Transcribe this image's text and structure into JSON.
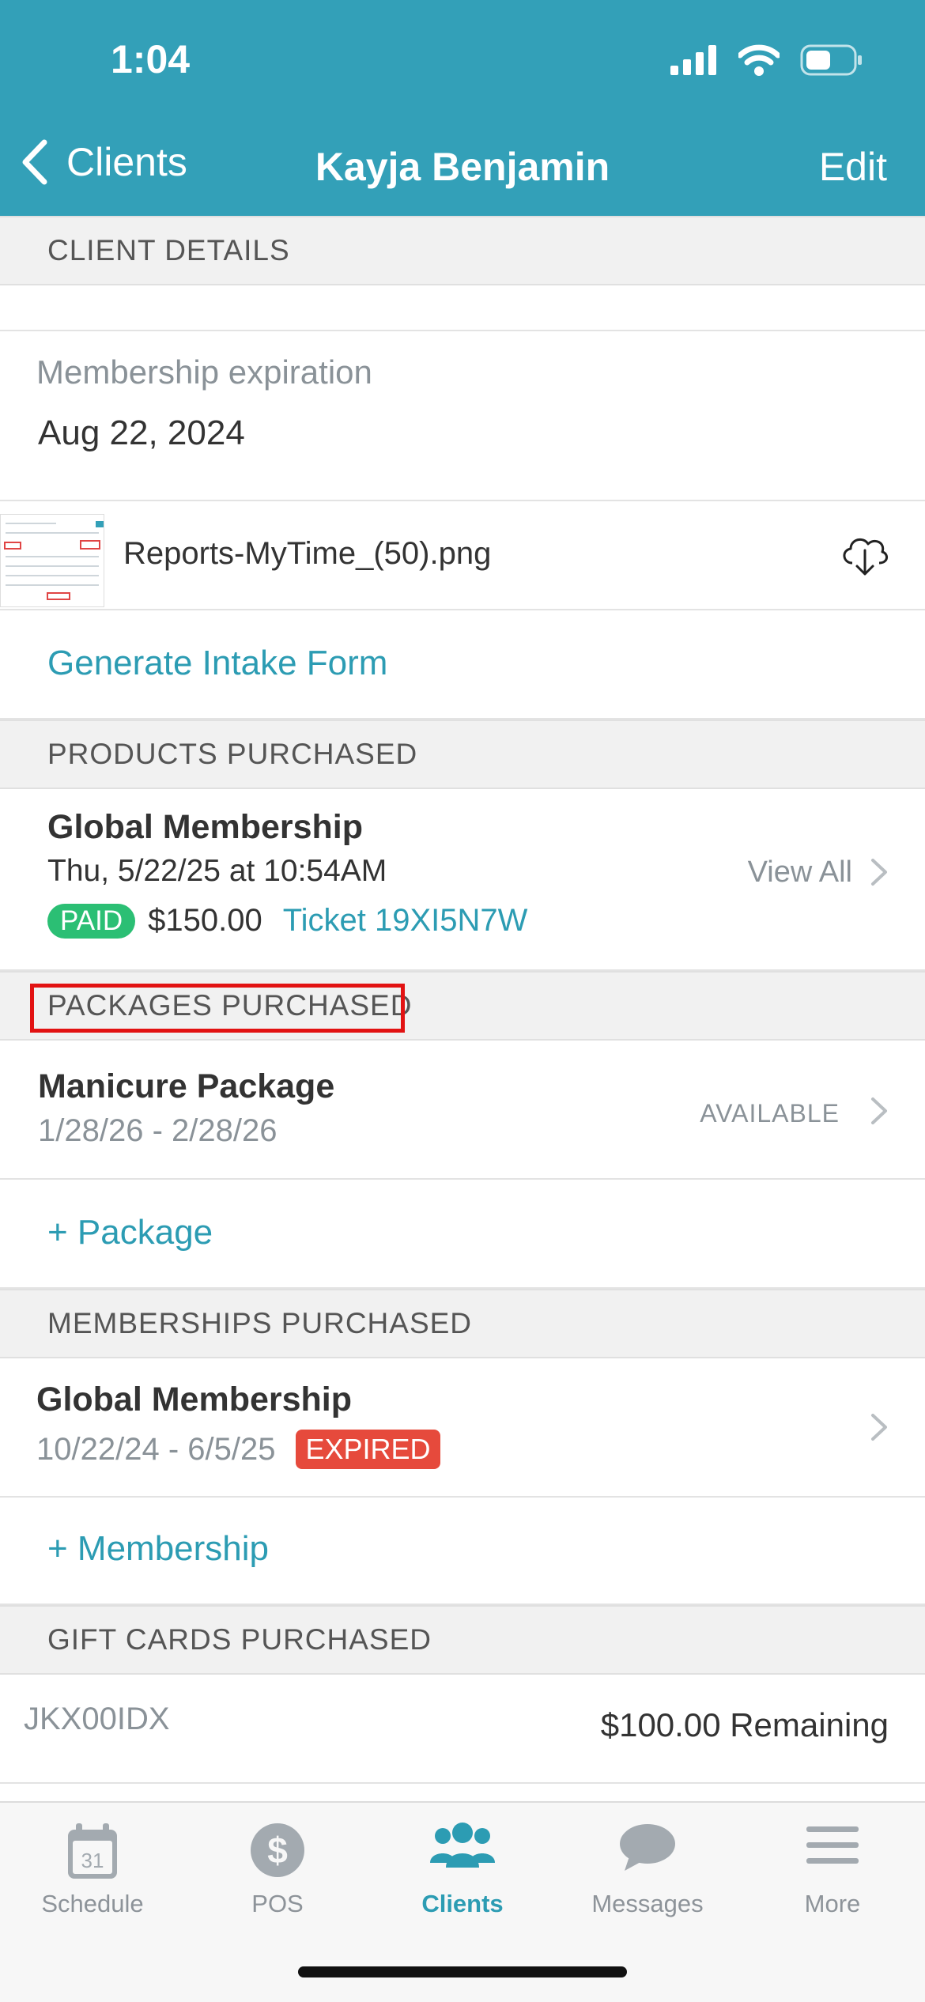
{
  "status": {
    "time": "1:04"
  },
  "nav": {
    "back_label": "Clients",
    "title": "Kayja Benjamin",
    "edit_label": "Edit"
  },
  "sections": {
    "client_details": "CLIENT DETAILS",
    "products": "PRODUCTS PURCHASED",
    "packages": "PACKAGES PURCHASED",
    "memberships": "MEMBERSHIPS PURCHASED",
    "gift_cards": "GIFT CARDS PURCHASED"
  },
  "client": {
    "membership_expiration_label": "Membership expiration",
    "membership_expiration_value": "Aug 22, 2024",
    "attachment_name": "Reports-MyTime_(50).png",
    "generate_intake": "Generate Intake Form"
  },
  "product": {
    "name": "Global Membership",
    "date": "Thu, 5/22/25 at 10:54AM",
    "status": "PAID",
    "amount": "$150.00",
    "ticket": "Ticket 19XI5N7W",
    "view_all": "View All"
  },
  "package": {
    "name": "Manicure Package",
    "dates": "1/28/26 - 2/28/26",
    "status": "AVAILABLE",
    "add_label": "+ Package"
  },
  "membership": {
    "name": "Global Membership",
    "dates": "10/22/24 - 6/5/25",
    "status": "EXPIRED",
    "add_label": "+ Membership"
  },
  "gift_card": {
    "code": "JKX00IDX",
    "remaining": "$100.00 Remaining"
  },
  "tabs": [
    {
      "label": "Schedule",
      "icon": "calendar-icon",
      "cal_day": "31"
    },
    {
      "label": "POS",
      "icon": "dollar-icon"
    },
    {
      "label": "Clients",
      "icon": "clients-icon"
    },
    {
      "label": "Messages",
      "icon": "message-icon"
    },
    {
      "label": "More",
      "icon": "menu-icon"
    }
  ],
  "colors": {
    "header": "#33a0b8",
    "accent": "#2c9cb3",
    "paid": "#2bbf74",
    "expired": "#e64a3c",
    "highlight": "#e21212"
  }
}
